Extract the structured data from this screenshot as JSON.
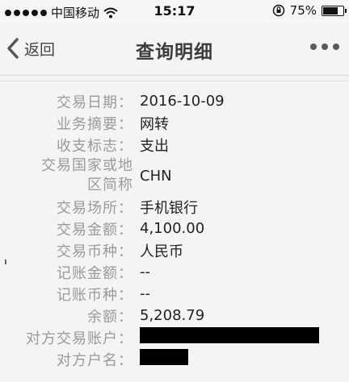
{
  "status_bar": {
    "carrier": "中国移动",
    "time": "15:17",
    "battery_percent": "75%",
    "battery_level": 0.75
  },
  "nav": {
    "back_label": "返回",
    "title": "查询明细"
  },
  "details": [
    {
      "label": "交易日期：",
      "value": "2016-10-09"
    },
    {
      "label": "业务摘要：",
      "value": "网转"
    },
    {
      "label": "收支标志：",
      "value": "支出"
    },
    {
      "label_line1": "交易国家或地",
      "label_line2": "区简称",
      "value": "CHN"
    },
    {
      "label": "交易场所：",
      "value": "手机银行"
    },
    {
      "label": "交易金额：",
      "value": "4,100.00"
    },
    {
      "label": "交易币种：",
      "value": "人民币"
    },
    {
      "label": "记账金额：",
      "value": "--"
    },
    {
      "label": "记账币种：",
      "value": "--"
    },
    {
      "label": "余额：",
      "value": "5,208.79"
    },
    {
      "label": "对方交易账户：",
      "value": ""
    },
    {
      "label": "对方户名：",
      "value": ""
    }
  ]
}
